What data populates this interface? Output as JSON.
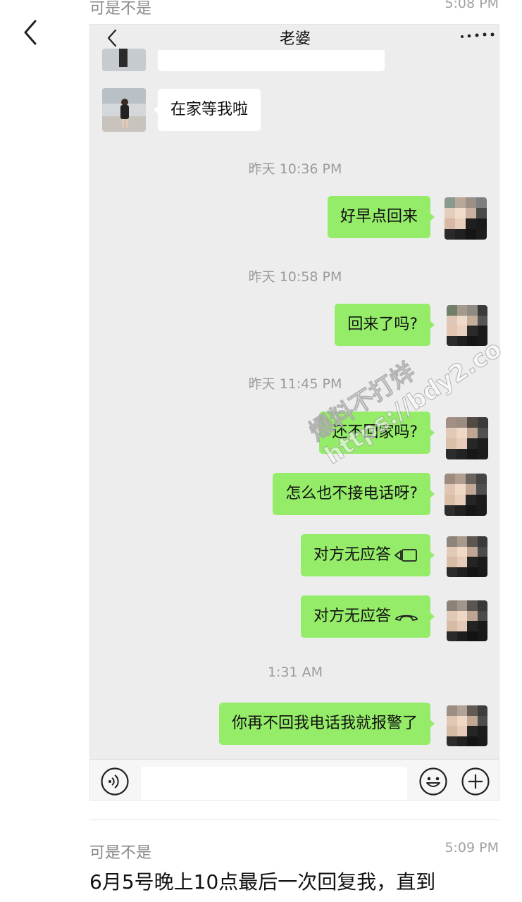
{
  "post_top": {
    "author": "可是不是",
    "time": "5:08 PM"
  },
  "chat": {
    "title": "老婆",
    "more_icon": "more-dots-icon",
    "messages": [
      {
        "side": "left",
        "text": "在家等我啦"
      },
      {
        "type": "timestamp",
        "text": "昨天 10:36 PM"
      },
      {
        "side": "right",
        "text": "好早点回来"
      },
      {
        "type": "timestamp",
        "text": "昨天 10:58 PM"
      },
      {
        "side": "right",
        "text": "回来了吗?"
      },
      {
        "type": "timestamp",
        "text": "昨天 11:45 PM"
      },
      {
        "side": "right",
        "text": "还不回家吗?"
      },
      {
        "side": "right",
        "text": "怎么也不接电话呀?"
      },
      {
        "side": "right",
        "text": "对方无应答",
        "icon": "video-call-icon"
      },
      {
        "side": "right",
        "text": "对方无应答",
        "icon": "voice-call-icon"
      },
      {
        "type": "timestamp",
        "text": "1:31 AM"
      },
      {
        "side": "right",
        "text": "你再不回我电话我就报警了"
      }
    ]
  },
  "watermark": {
    "line1": "爆料不打烊",
    "line2": "https://bdy2.co"
  },
  "post_bottom": {
    "author": "可是不是",
    "time": "5:09 PM",
    "text": "6月5号晚上10点最后一次回复我，直到"
  },
  "colors": {
    "bubble_green": "#95ec69",
    "chat_bg": "#ededed"
  }
}
